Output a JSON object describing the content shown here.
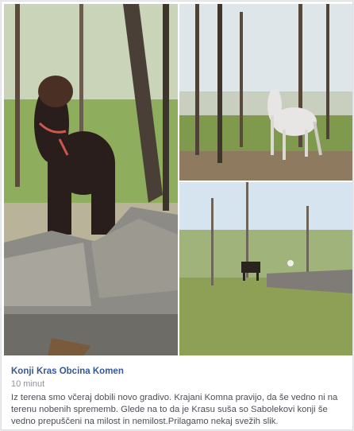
{
  "post": {
    "page_name": "Konji Kras Obcina Komen",
    "timestamp": "10 minut",
    "text": "Iz terena smo včeraj dobili novo gradivo. Krajani Komna pravijo, da še vedno ni na terenu nobenih sprememb. Glede na to da je Krasu suša so Sabolekovi konji še vedno prepuščeni na milost in nemilost.Prilagamo nekaj svežih slik."
  },
  "photos": [
    {
      "subject": "dark-brown-horse-behind-stone-wall"
    },
    {
      "subject": "white-horse-in-forest"
    },
    {
      "subject": "horses-in-clearing-by-stone-wall"
    }
  ],
  "colors": {
    "link": "#365899",
    "secondary_text": "#90949c",
    "body_text": "#4b4f56",
    "card_border": "#dddfe2"
  }
}
